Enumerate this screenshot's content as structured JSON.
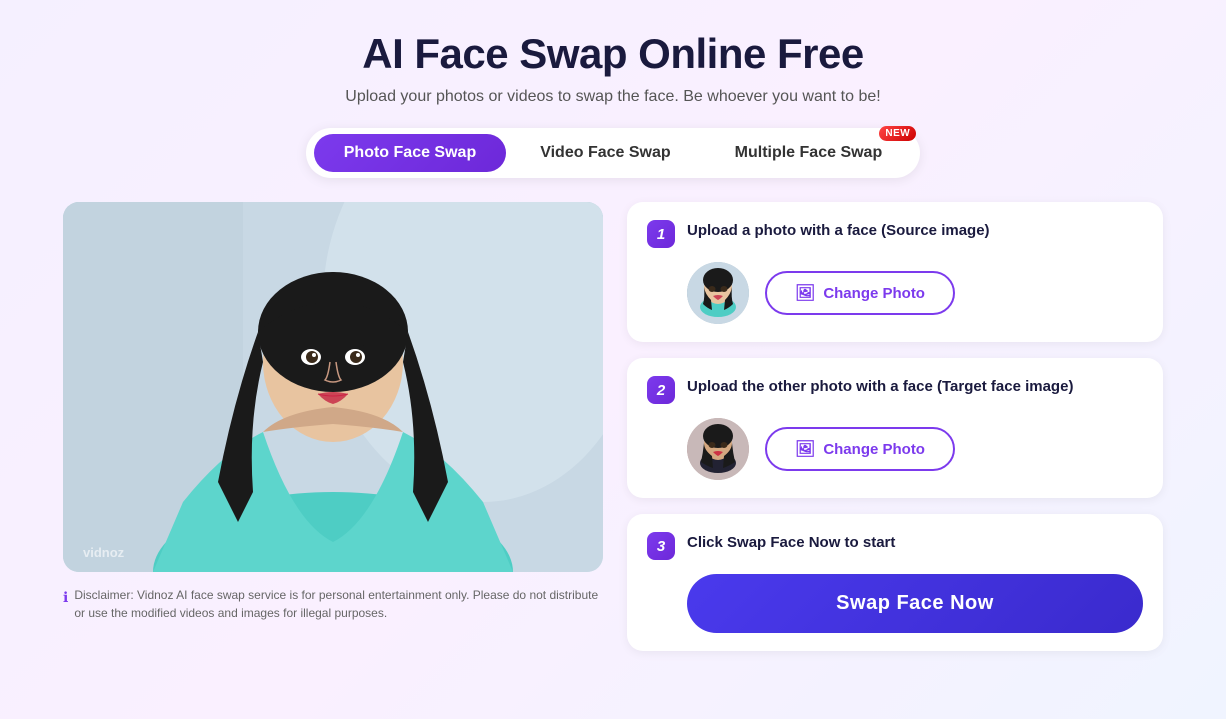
{
  "header": {
    "title": "AI Face Swap Online Free",
    "subtitle": "Upload your photos or videos to swap the face. Be whoever you want to be!"
  },
  "tabs": [
    {
      "id": "photo",
      "label": "Photo Face Swap",
      "active": true,
      "new": false
    },
    {
      "id": "video",
      "label": "Video Face Swap",
      "active": false,
      "new": false
    },
    {
      "id": "multiple",
      "label": "Multiple Face Swap",
      "active": false,
      "new": true
    }
  ],
  "new_badge": "NEW",
  "steps": [
    {
      "number": "1",
      "title": "Upload a photo with a face (Source image)",
      "change_btn": "Change Photo"
    },
    {
      "number": "2",
      "title": "Upload the other photo with a face (Target face image)",
      "change_btn": "Change Photo"
    },
    {
      "number": "3",
      "title": "Click Swap Face Now to start",
      "swap_btn": "Swap Face Now"
    }
  ],
  "disclaimer": {
    "text": "Disclaimer: Vidnoz AI face swap service is for personal entertainment only. Please do not distribute or use the modified videos and images for illegal purposes."
  },
  "watermark": "vidnoz",
  "colors": {
    "accent": "#7c3aed",
    "accent_dark": "#3a2acd",
    "new_badge": "#ff3333"
  }
}
